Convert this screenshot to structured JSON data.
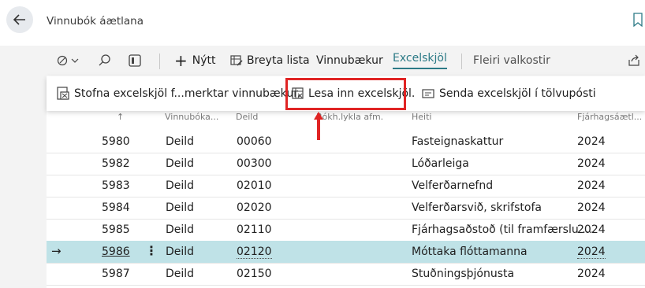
{
  "page": {
    "title": "Vinnubók áætlana"
  },
  "actionbar": {
    "new_label": "Nýtt",
    "edit_list_label": "Breyta lista",
    "workbooks_label": "Vinnubækur",
    "excel_label": "Excelskjöl",
    "more_label": "Fleiri valkostir"
  },
  "submenu": {
    "create_label": "Stofna excelskjöl f...merktar vinnubækur.",
    "import_label": "Lesa inn excelskjöl.",
    "send_label": "Senda excelskjöl í tölvupósti"
  },
  "table": {
    "headers": {
      "sort_arrow": "↑",
      "workbook": "Vinnubóka...",
      "dept": "Deild",
      "acct": "Bókh.lykla afm.",
      "name": "Heiti",
      "year": "Fjárhagsáætl..."
    },
    "rows": [
      {
        "no": "5980",
        "type": "Deild",
        "dept": "00060",
        "name": "Fasteignaskattur",
        "year": "2024"
      },
      {
        "no": "5982",
        "type": "Deild",
        "dept": "00300",
        "name": "Lóðarleiga",
        "year": "2024"
      },
      {
        "no": "5983",
        "type": "Deild",
        "dept": "02010",
        "name": "Velferðarnefnd",
        "year": "2024"
      },
      {
        "no": "5984",
        "type": "Deild",
        "dept": "02020",
        "name": "Velferðarsvið, skrifstofa",
        "year": "2024"
      },
      {
        "no": "5985",
        "type": "Deild",
        "dept": "02110",
        "name": "Fjárhagsaðstoð (til framfærslu ...",
        "year": "2024"
      },
      {
        "no": "5986",
        "type": "Deild",
        "dept": "02120",
        "name": "Móttaka flóttamanna",
        "year": "2024"
      },
      {
        "no": "5987",
        "type": "Deild",
        "dept": "02150",
        "name": "Stuðningsþjónusta",
        "year": "2024"
      }
    ]
  },
  "colors": {
    "accent": "#2c7a86",
    "highlight": "#e02424",
    "selected_row": "#bfe2e7"
  }
}
